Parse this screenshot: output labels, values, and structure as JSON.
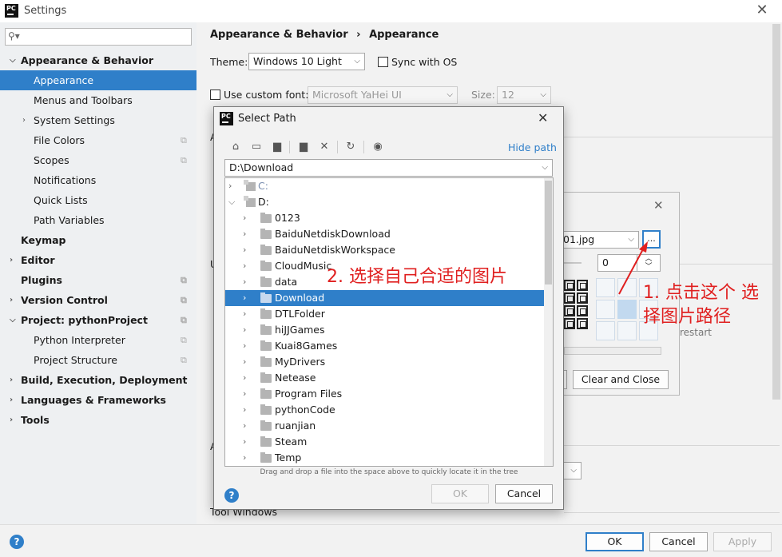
{
  "window": {
    "title": "Settings",
    "logo_text": "PC"
  },
  "search": {
    "placeholder": "",
    "icon": "search-icon"
  },
  "sidebar": {
    "items": [
      {
        "label": "Appearance & Behavior",
        "bold": true,
        "expanded": true
      },
      {
        "label": "Appearance",
        "selected": true
      },
      {
        "label": "Menus and Toolbars"
      },
      {
        "label": "System Settings",
        "collapsed": true
      },
      {
        "label": "File Colors"
      },
      {
        "label": "Scopes"
      },
      {
        "label": "Notifications"
      },
      {
        "label": "Quick Lists"
      },
      {
        "label": "Path Variables"
      },
      {
        "label": "Keymap",
        "bold": true
      },
      {
        "label": "Editor",
        "bold": true,
        "collapsed": true
      },
      {
        "label": "Plugins",
        "bold": true
      },
      {
        "label": "Version Control",
        "bold": true,
        "collapsed": true
      },
      {
        "label": "Project: pythonProject",
        "bold": true,
        "expanded": true
      },
      {
        "label": "Python Interpreter"
      },
      {
        "label": "Project Structure"
      },
      {
        "label": "Build, Execution, Deployment",
        "bold": true,
        "collapsed": true
      },
      {
        "label": "Languages & Frameworks",
        "bold": true,
        "collapsed": true
      },
      {
        "label": "Tools",
        "bold": true,
        "collapsed": true
      }
    ]
  },
  "main": {
    "breadcrumb": {
      "parent": "Appearance & Behavior",
      "separator": "›",
      "current": "Appearance"
    },
    "theme_label": "Theme:",
    "theme_value": "Windows 10 Light",
    "sync_os_label": "Sync with OS",
    "custom_font_label": "Use custom font:",
    "font_value": "Microsoft YaHei UI",
    "size_label": "Size:",
    "size_value": "12",
    "partial_text": {
      "a1": "A",
      "u": "U",
      "a2": "A",
      "tool_windows": "Tool Windows",
      "restart": "restart"
    }
  },
  "bg_dialog": {
    "file_value": "01.jpg",
    "browse_label": "...",
    "opacity_value": "0",
    "clear_close_label": "Clear and Close"
  },
  "select_path": {
    "title": "Select Path",
    "hide_path_label": "Hide path",
    "path_value": "D:\\Download",
    "toolbar_icons": [
      "home-icon",
      "desktop-icon",
      "project-folder-icon",
      "new-folder-icon",
      "delete-icon",
      "refresh-icon",
      "show-hidden-icon"
    ],
    "tree": [
      {
        "label": "C:",
        "level": 0,
        "expanded": false,
        "drive": true
      },
      {
        "label": "D:",
        "level": 0,
        "expanded": true,
        "drive": true
      },
      {
        "label": "0123",
        "level": 1
      },
      {
        "label": "BaiduNetdiskDownload",
        "level": 1
      },
      {
        "label": "BaiduNetdiskWorkspace",
        "level": 1
      },
      {
        "label": "CloudMusic",
        "level": 1
      },
      {
        "label": "data",
        "level": 1
      },
      {
        "label": "Download",
        "level": 1,
        "selected": true
      },
      {
        "label": "DTLFolder",
        "level": 1
      },
      {
        "label": "hiJJGames",
        "level": 1
      },
      {
        "label": "Kuai8Games",
        "level": 1
      },
      {
        "label": "MyDrivers",
        "level": 1
      },
      {
        "label": "Netease",
        "level": 1
      },
      {
        "label": "Program Files",
        "level": 1
      },
      {
        "label": "pythonCode",
        "level": 1
      },
      {
        "label": "ruanjian",
        "level": 1
      },
      {
        "label": "Steam",
        "level": 1
      },
      {
        "label": "Temp",
        "level": 1
      }
    ],
    "hint": "Drag and drop a file into the space above to quickly locate it in the tree",
    "ok_label": "OK",
    "cancel_label": "Cancel"
  },
  "bottom": {
    "ok_label": "OK",
    "cancel_label": "Cancel",
    "apply_label": "Apply"
  },
  "annotations": {
    "step1_line1": "1. 点击这个 选",
    "step1_line2": "择图片路径",
    "step2": "2. 选择自己合适的图片"
  },
  "colors": {
    "accent": "#2f7fc9",
    "annotation": "#e02020",
    "sidebar_bg": "#eef0f2"
  }
}
